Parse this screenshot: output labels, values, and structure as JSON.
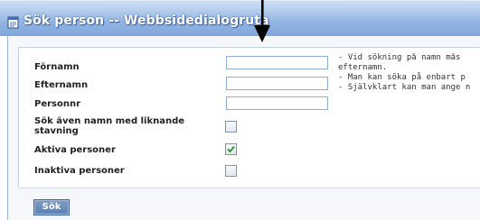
{
  "window": {
    "title": "Sök person -- Webbsidedialogruta",
    "icon": "window-page-icon"
  },
  "form": {
    "fields": [
      {
        "label": "Förnamn",
        "value": ""
      },
      {
        "label": "Efternamn",
        "value": ""
      },
      {
        "label": "Personnr",
        "value": ""
      }
    ],
    "checkboxes": [
      {
        "label_line1": "Sök även namn med liknande",
        "label_line2": "stavning",
        "checked": false
      },
      {
        "label": "Aktiva personer",
        "checked": true
      },
      {
        "label": "Inaktiva personer",
        "checked": false
      }
    ],
    "help_text": "- Vid sökning på namn mås\nefternamn.\n- Man kan söka på enbart p\n- Självklart kan man ange n",
    "search_button_label": "Sök"
  },
  "annotation": {
    "arrow_icon": "down-arrow-icon"
  },
  "colors": {
    "titlebar": "#93b5e3",
    "title_text": "#ffffff",
    "check_mark": "#2e8b2e",
    "button": "#6b8cba"
  }
}
